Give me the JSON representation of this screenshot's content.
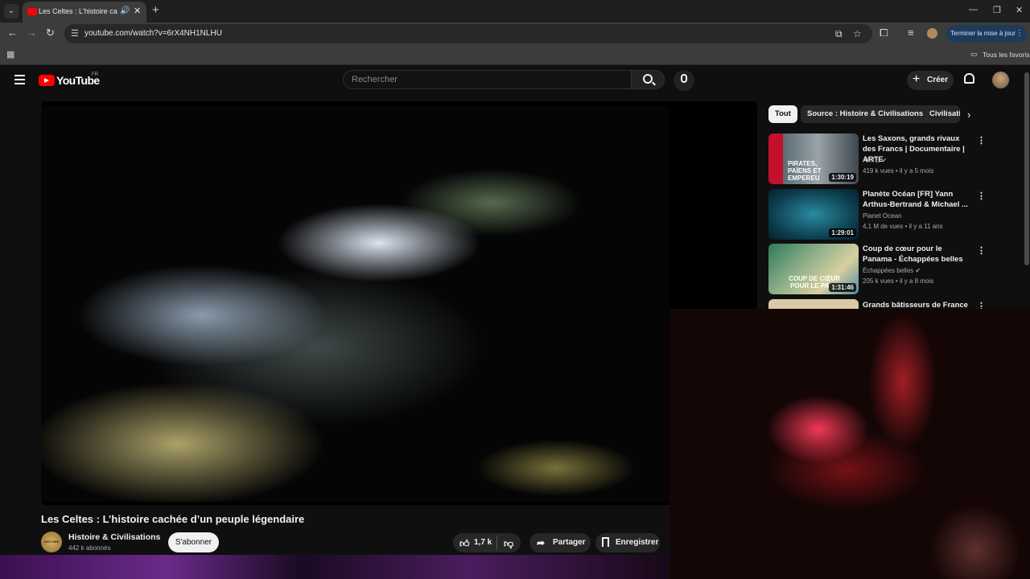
{
  "browser": {
    "tab_title": "Les Celtes : L'histoire cachée",
    "url": "youtube.com/watch?v=6rX4NH1NLHU",
    "update_button": "Terminer la mise à jour",
    "bookmarks_folder": "Tous les favoris"
  },
  "header": {
    "logo": "YouTube",
    "country": "FR",
    "search_placeholder": "Rechercher",
    "create_label": "Créer"
  },
  "video": {
    "title": "Les Celtes : L’histoire cachée d’un peuple légendaire",
    "channel_name": "Histoire & Civilisations",
    "channel_avatar_text": "HISTOIRE",
    "subscribers": "442 k abonnés",
    "subscribe_label": "S'abonner",
    "likes": "1,7 k",
    "share_label": "Partager",
    "save_label": "Enregistrer"
  },
  "sidebar": {
    "chips": [
      "Tout",
      "Source : Histoire & Civilisations",
      "Civilisations"
    ],
    "recommendations": [
      {
        "title": "Les Saxons, grands rivaux des Francs | Documentaire | ARTE",
        "channel": "ARTE",
        "views": "419 k vues",
        "age": "il y a 5 mois",
        "duration": "1:30:19",
        "thumb_text": "PIRATES, PAÏENS ET EMPEREU",
        "verified": true
      },
      {
        "title": "Planète Océan [FR] Yann Arthus-Bertrand & Michael ...",
        "channel": "Planet Ocean",
        "views": "4,1 M de vues",
        "age": "il y a 11 ans",
        "duration": "1:29:01",
        "thumb_text": "",
        "verified": false
      },
      {
        "title": "Coup de cœur pour le Panama - Échappées belles",
        "channel": "Échappées belles",
        "views": "205 k vues",
        "age": "il y a 8 mois",
        "duration": "1:31:46",
        "thumb_text": "COUP DE CŒUR POUR LE PANA",
        "verified": true
      },
      {
        "title": "Grands bâtisseurs de France :",
        "channel": "",
        "views": "",
        "age": "",
        "duration": "",
        "thumb_text": "",
        "verified": false
      }
    ]
  },
  "colors": {
    "brand": "#ff0000",
    "background": "#0f0f0f",
    "chip_active": "#f1f1f1"
  }
}
